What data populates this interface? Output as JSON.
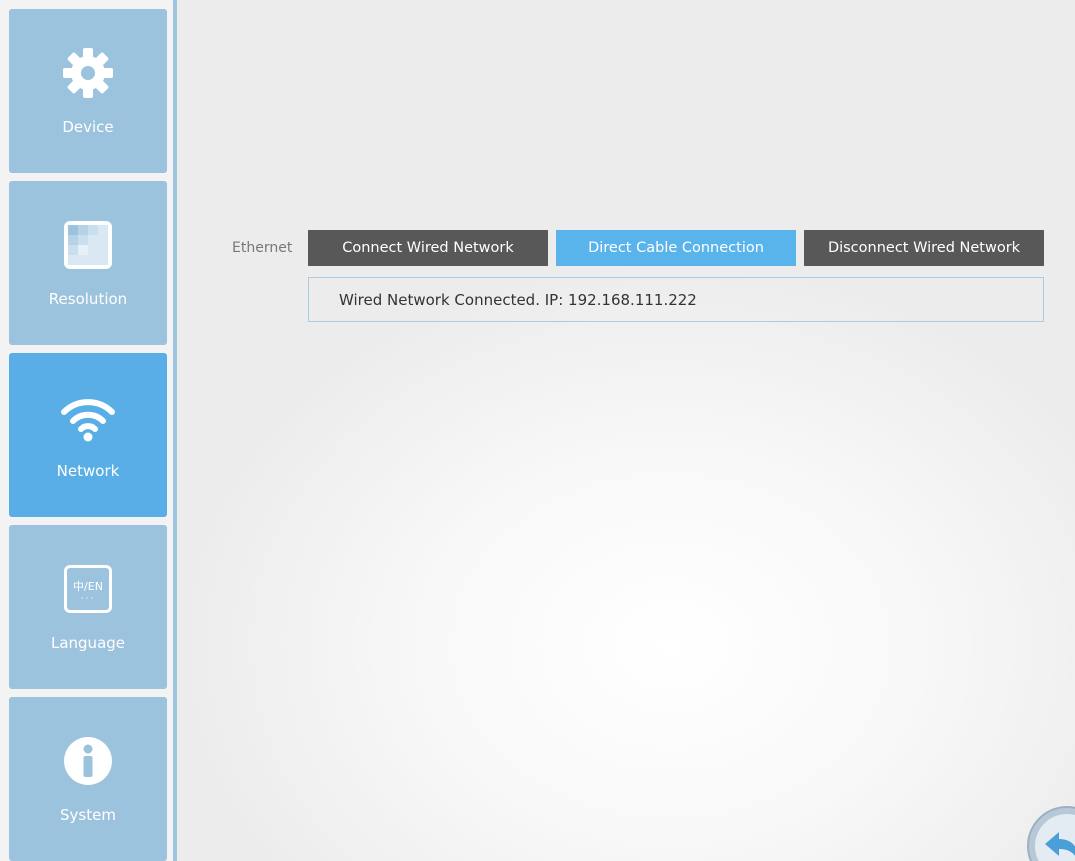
{
  "sidebar": {
    "items": [
      {
        "label": "Device",
        "icon": "gear-icon",
        "active": false
      },
      {
        "label": "Resolution",
        "icon": "resolution-icon",
        "active": false
      },
      {
        "label": "Network",
        "icon": "wifi-icon",
        "active": true
      },
      {
        "label": "Language",
        "icon": "language-icon",
        "active": false,
        "icon_text": "中/EN"
      },
      {
        "label": "System",
        "icon": "info-icon",
        "active": false
      }
    ]
  },
  "ethernet": {
    "label": "Ethernet",
    "connect_label": "Connect Wired Network",
    "direct_label": "Direct Cable Connection",
    "disconnect_label": "Disconnect Wired Network",
    "status": "Wired Network Connected. IP:  192.168.111.222"
  },
  "back_button": {
    "icon": "back-arrow-icon"
  },
  "colors": {
    "sidebar_inactive": "#9cc3de",
    "sidebar_active": "#5aaee6",
    "button_dark": "#585858",
    "button_accent": "#5ab4ec"
  }
}
